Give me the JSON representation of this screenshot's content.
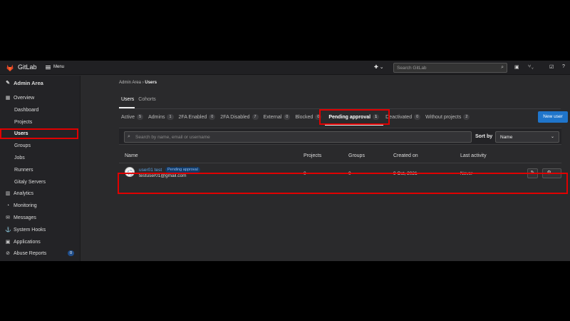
{
  "navbar": {
    "brand": "GitLab",
    "menu_label": "Menu",
    "plus_label": "✚ ⌄",
    "search_placeholder": "Search GitLab",
    "icons": [
      "search-icon",
      "todo-icon",
      "merge-request-icon",
      "issues-icon"
    ]
  },
  "sidebar": {
    "header": "Admin Area",
    "items": [
      {
        "label": "Overview",
        "icon": "grid-icon"
      },
      {
        "label": "Dashboard"
      },
      {
        "label": "Projects"
      },
      {
        "label": "Users"
      },
      {
        "label": "Groups"
      },
      {
        "label": "Jobs"
      },
      {
        "label": "Runners"
      },
      {
        "label": "Gitaly Servers"
      },
      {
        "label": "Analytics",
        "icon": "chart-icon"
      },
      {
        "label": "Monitoring",
        "icon": "monitor-icon"
      },
      {
        "label": "Messages",
        "icon": "messages-icon"
      },
      {
        "label": "System Hooks",
        "icon": "hook-icon"
      },
      {
        "label": "Applications",
        "icon": "applications-icon"
      },
      {
        "label": "Abuse Reports",
        "icon": "abuse-icon",
        "badge": "0"
      }
    ]
  },
  "breadcrumb": {
    "parent": "Admin Area",
    "sep": "›",
    "current": "Users"
  },
  "subtabs": [
    "Users",
    "Cohorts"
  ],
  "filter_tabs": [
    {
      "label": "Active",
      "count": "5"
    },
    {
      "label": "Admins",
      "count": "1"
    },
    {
      "label": "2FA Enabled",
      "count": "0"
    },
    {
      "label": "2FA Disabled",
      "count": "7"
    },
    {
      "label": "External",
      "count": "0"
    },
    {
      "label": "Blocked",
      "count": "0"
    },
    {
      "label": "Pending approval",
      "count": "1"
    },
    {
      "label": "Deactivated",
      "count": "0"
    },
    {
      "label": "Without projects",
      "count": "2"
    }
  ],
  "new_user_label": "New user",
  "user_search_placeholder": "Search by name, email or username",
  "sort": {
    "label": "Sort by",
    "value": "Name"
  },
  "table": {
    "headers": [
      "Name",
      "Projects",
      "Groups",
      "Created on",
      "Last activity"
    ],
    "rows": [
      {
        "name": "user01 test",
        "badge": "Pending approval",
        "email": "testuser01@gmail.com",
        "projects": "0",
        "groups": "0",
        "created_on": "9 Oct, 2021",
        "last_activity": "Never"
      }
    ]
  },
  "colors": {
    "highlight": "#e00000",
    "primary": "#1f75cb"
  }
}
